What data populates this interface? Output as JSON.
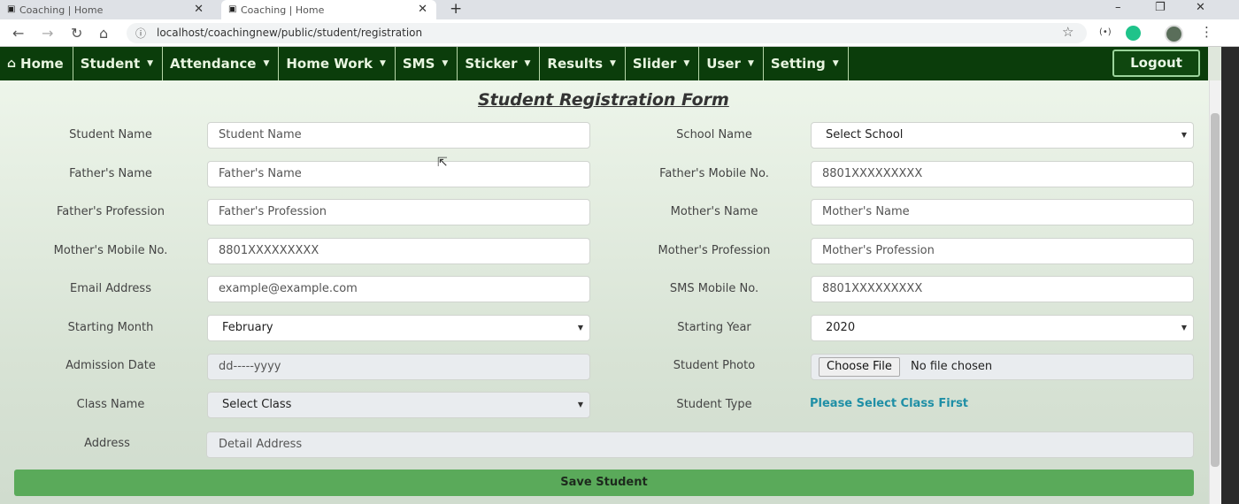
{
  "browser": {
    "tabs": [
      {
        "title": "Coaching | Home"
      },
      {
        "title": "Coaching | Home"
      }
    ],
    "new_tab": "+",
    "url": "localhost/coachingnew/public/student/registration",
    "window_controls": {
      "minimize": "–",
      "restore": "❐",
      "close": "✕"
    }
  },
  "nav": {
    "items": [
      {
        "label": "Home",
        "icon": "home-icon"
      },
      {
        "label": "Student"
      },
      {
        "label": "Attendance"
      },
      {
        "label": "Home Work"
      },
      {
        "label": "SMS"
      },
      {
        "label": "Sticker"
      },
      {
        "label": "Results"
      },
      {
        "label": "Slider"
      },
      {
        "label": "User"
      },
      {
        "label": "Setting"
      }
    ],
    "logout": "Logout"
  },
  "form": {
    "title": "Student Registration Form",
    "student_name": {
      "label": "Student Name",
      "placeholder": "Student Name"
    },
    "school_name": {
      "label": "School Name",
      "value": "Select School"
    },
    "fathers_name": {
      "label": "Father's Name",
      "placeholder": "Father's Name"
    },
    "fathers_mobile": {
      "label": "Father's Mobile No.",
      "placeholder": "8801XXXXXXXXX"
    },
    "fathers_profession": {
      "label": "Father's Profession",
      "placeholder": "Father's Profession"
    },
    "mothers_name": {
      "label": "Mother's Name",
      "placeholder": "Mother's Name"
    },
    "mothers_mobile": {
      "label": "Mother's Mobile No.",
      "placeholder": "8801XXXXXXXXX"
    },
    "mothers_profession": {
      "label": "Mother's Profession",
      "placeholder": "Mother's Profession"
    },
    "email": {
      "label": "Email Address",
      "placeholder": "example@example.com"
    },
    "sms_mobile": {
      "label": "SMS Mobile No.",
      "placeholder": "8801XXXXXXXXX"
    },
    "starting_month": {
      "label": "Starting Month",
      "value": "February"
    },
    "starting_year": {
      "label": "Starting Year",
      "value": "2020"
    },
    "admission_date": {
      "label": "Admission Date",
      "placeholder": "dd-----yyyy"
    },
    "student_photo": {
      "label": "Student Photo",
      "button": "Choose File",
      "status": "No file chosen"
    },
    "class_name": {
      "label": "Class Name",
      "value": "Select Class"
    },
    "student_type": {
      "label": "Student Type",
      "message": "Please Select Class First"
    },
    "address": {
      "label": "Address",
      "placeholder": "Detail Address"
    },
    "save_button": "Save Student"
  }
}
